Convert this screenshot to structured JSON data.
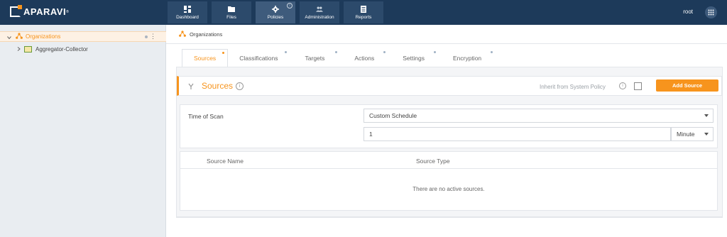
{
  "app": {
    "brand": "APARAVI",
    "brand_mark": "®"
  },
  "nav": {
    "items": [
      {
        "label": "Dashboard",
        "icon": "dashboard-icon"
      },
      {
        "label": "Files",
        "icon": "folder-icon"
      },
      {
        "label": "Policies",
        "icon": "gear-icon",
        "active": true,
        "info": "i"
      },
      {
        "label": "Administration",
        "icon": "users-icon"
      },
      {
        "label": "Reports",
        "icon": "report-icon"
      }
    ]
  },
  "header": {
    "user": "root",
    "apps_icon": "grid-icon"
  },
  "sidebar": {
    "root": {
      "label": "Organizations",
      "icon": "organization-icon",
      "more": "⋮"
    },
    "children": [
      {
        "label": "Aggregator-Collector",
        "icon": "computer-icon"
      }
    ]
  },
  "breadcrumb": {
    "label": "Organizations"
  },
  "tabs": [
    {
      "label": "Sources",
      "active": true
    },
    {
      "label": "Classifications"
    },
    {
      "label": "Targets"
    },
    {
      "label": "Actions"
    },
    {
      "label": "Settings"
    },
    {
      "label": "Encryption"
    }
  ],
  "section": {
    "title": "Sources",
    "info": "i",
    "inherit_label": "Inherit from System Policy",
    "inherit_info": "i",
    "inherit_checked": false,
    "add_button": "Add Source"
  },
  "scan": {
    "label": "Time of Scan",
    "schedule": "Custom Schedule",
    "interval": "1",
    "unit": "Minute"
  },
  "table": {
    "columns": [
      "Source Name",
      "Source Type"
    ],
    "empty_message": "There are no active sources."
  },
  "colors": {
    "topbar": "#1d3a5a",
    "accent": "#f7941d",
    "sidebar": "#e9edf1"
  }
}
